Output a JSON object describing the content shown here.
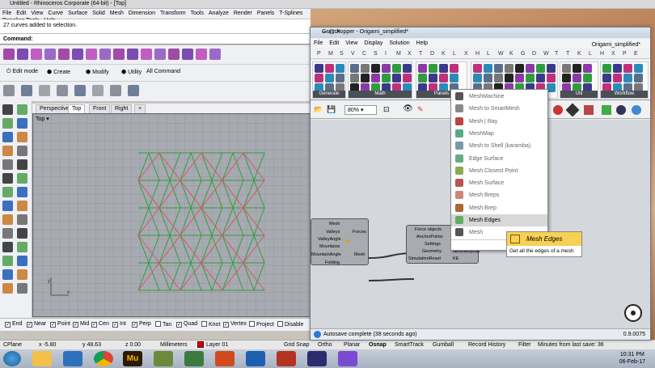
{
  "rhino": {
    "title": "Untitled - Rhinoceros Corporate (64-bit) - [Top]",
    "menu": [
      "File",
      "Edit",
      "View",
      "Curve",
      "Surface",
      "Solid",
      "Mesh",
      "Dimension",
      "Transform",
      "Tools",
      "Analyze",
      "Render",
      "Panels",
      "T-Splines",
      "Paneling Tools",
      "Help"
    ],
    "output": "27 curves added to selection.",
    "command_label": "Command:",
    "modes": [
      "Edit mode",
      "Create",
      "Modify",
      "Utility",
      "All Command"
    ],
    "viewport_tabs": [
      "Perspective",
      "Top",
      "Front",
      "Right"
    ],
    "viewport_label": "Top",
    "osnaps": [
      {
        "label": "End",
        "on": true
      },
      {
        "label": "Near",
        "on": true
      },
      {
        "label": "Point",
        "on": true
      },
      {
        "label": "Mid",
        "on": true
      },
      {
        "label": "Cen",
        "on": true
      },
      {
        "label": "Int",
        "on": true
      },
      {
        "label": "Perp",
        "on": true
      },
      {
        "label": "Tan",
        "on": false
      },
      {
        "label": "Quad",
        "on": true
      },
      {
        "label": "Knot",
        "on": false
      },
      {
        "label": "Vertex",
        "on": true
      },
      {
        "label": "Project",
        "on": false
      },
      {
        "label": "Disable",
        "on": false
      }
    ],
    "status": {
      "cplane": "CPlane",
      "x": "x -5.80",
      "y": "y 48.63",
      "z": "z 0.00",
      "units": "Millimeters",
      "layer": "Layer 01",
      "grid_snap": "Grid Snap",
      "ortho": "Ortho",
      "planar": "Planar",
      "osnap": "Osnap",
      "smarttrack": "SmartTrack",
      "gumball": "Gumball",
      "record_history": "Record History",
      "filter": "Filter",
      "last_save": "Minutes from last save: 36"
    },
    "colors": {
      "valley": "#d9536b",
      "mountain": "#2f9d3f",
      "accent": "#cc0000"
    }
  },
  "gh": {
    "title": "Grasshopper - Origami_simplified*",
    "menu": [
      "File",
      "Edit",
      "View",
      "Display",
      "Solution",
      "Help"
    ],
    "document": "Origami_simplified*",
    "cat_tabs": [
      "P",
      "M",
      "S",
      "V",
      "C",
      "S",
      "I",
      "M",
      "X",
      "T",
      "D",
      "K",
      "L",
      "X",
      "H",
      "L",
      "W",
      "K",
      "G",
      "D",
      "W",
      "T",
      "T",
      "K",
      "L",
      "H",
      "X",
      "P",
      "E"
    ],
    "groups": [
      "Generate",
      "Math",
      "Panels",
      "Util",
      "Workflow"
    ],
    "zoom": "80%",
    "status": "Autosave complete (38 seconds ago)",
    "version": "0.9.0075",
    "component1": {
      "inputs": [
        "Mesh",
        "Valleys",
        "ValleyAngle",
        "Mountains",
        "MountainAngle",
        "Folding"
      ],
      "outputs": [
        "Forces",
        "Mesh"
      ]
    },
    "component2": {
      "inputs": [
        "Force objects",
        "AnchorPoints",
        "Settings",
        "Geometry",
        "SimulationReset"
      ],
      "outputs": [
        "GeometryOut",
        "KE"
      ]
    },
    "dropdown": [
      "MeshMachine",
      "Mesh to SmartMesh",
      "Mesh | Ray",
      "MeshMap",
      "Mesh to Shell (karamba)",
      "Edge Surface",
      "Mesh Closest Point",
      "Mesh Surface",
      "Mesh Breps",
      "Mesh Brep",
      "Mesh Edges",
      "Mesh"
    ],
    "search": "mesh e",
    "tooltip": {
      "title": "Mesh Edges",
      "desc": "Get all the edges of a mesh"
    }
  },
  "taskbar": {
    "time": "10:31 PM",
    "date": "06-Feb-17"
  }
}
